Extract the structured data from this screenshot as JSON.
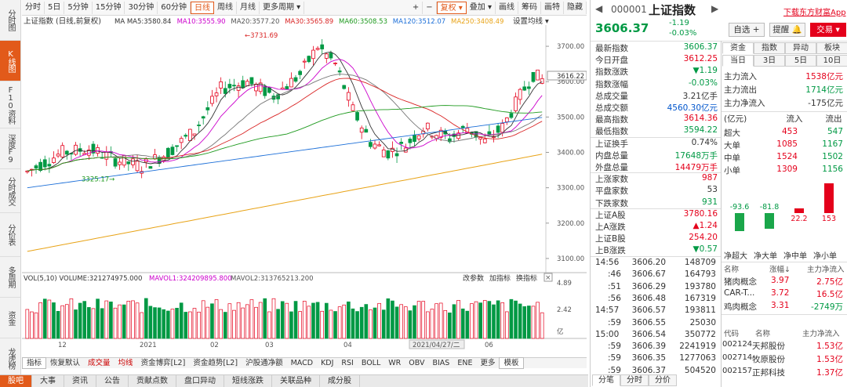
{
  "nav_left": [
    "分时图",
    "K线图",
    "F10资料",
    "深度F9",
    "分时成交",
    "分价表",
    "多周期",
    "资金",
    "龙虎榜"
  ],
  "toolbar": {
    "periods": [
      "分时",
      "5日",
      "5分钟",
      "15分钟",
      "30分钟",
      "60分钟",
      "日线",
      "周线",
      "月线",
      "更多周期"
    ],
    "active": "日线",
    "right": [
      "+",
      "−",
      "复权",
      "叠加",
      "画线",
      "筹码",
      "画特",
      "隐藏"
    ]
  },
  "chart": {
    "title": "上证指数 (日线,前复权)",
    "ma": [
      {
        "t": "MA MA5:3580.84",
        "c": "#333"
      },
      {
        "t": "MA10:3555.90",
        "c": "#cc00cc"
      },
      {
        "t": "MA20:3577.20",
        "c": "#555"
      },
      {
        "t": "MA30:3565.89",
        "c": "#d92424"
      },
      {
        "t": "MA60:3508.53",
        "c": "#1f9a1f"
      },
      {
        "t": "MA120:3512.07",
        "c": "#1c6fd8"
      },
      {
        "t": "MA250:3408.49",
        "c": "#e8a317"
      }
    ],
    "set_label": "设置均线",
    "high_label": "3731.69",
    "low_label": "3325.17",
    "last_label": "3616.22",
    "y_ticks": [
      "3700.00",
      "3600.00",
      "3500.00",
      "3400.00",
      "3300.00",
      "3200.00",
      "3100.00"
    ],
    "vol_title": "VOL(5,10) VOLUME:321274975.000",
    "vol_ma1": "MAVOL1:324209895.800",
    "vol_ma2": "MAVOL2:313765213.200",
    "vol_ticks": [
      "4.89",
      "2.42",
      "亿"
    ],
    "vol_tools": [
      "改参数",
      "加指标",
      "换指标"
    ],
    "x_ticks": [
      "12",
      "2021",
      "02",
      "03",
      "04",
      "2021/04/27/二",
      "06"
    ]
  },
  "bottom_tabs": [
    "指标",
    "恢复默认",
    "成交量",
    "均线",
    "资金博弈[L2]",
    "资金趋势[L2]",
    "沪股通净额",
    "MACD",
    "KDJ",
    "RSI",
    "BOLL",
    "WR",
    "OBV",
    "BIAS",
    "ENE",
    "更多",
    "模板"
  ],
  "bottom_nav": [
    "股吧",
    "大事",
    "资讯",
    "公告",
    "贡献点数",
    "盘口异动",
    "短线涨跌",
    "关联品种",
    "成分股"
  ],
  "right": {
    "code": "000001",
    "name": "上证指数",
    "download": "下载东方财富App",
    "price": "3606.37",
    "chg": "-1.19",
    "pct": "-0.03%",
    "btns": [
      "自选",
      "提醒",
      "交易"
    ],
    "stats": [
      [
        "最新指数",
        "3606.37",
        "grn"
      ],
      [
        "今日开盘",
        "3612.25",
        "red"
      ],
      [
        "指数涨跌",
        "▼1.19",
        "grn"
      ],
      [
        "指数涨幅",
        "-0.03%",
        "grn"
      ],
      [
        "总成交量",
        "3.21亿手",
        ""
      ],
      [
        "总成交额",
        "4560.30亿元",
        "blu"
      ],
      [
        "最高指数",
        "3614.36",
        "red"
      ],
      [
        "最低指数",
        "3594.22",
        "grn"
      ],
      [
        "上证换手",
        "0.74%",
        ""
      ],
      [
        "内盘总量",
        "17648万手",
        "grn"
      ],
      [
        "外盘总量",
        "14479万手",
        "red"
      ],
      [
        "上涨家数",
        "987",
        "red"
      ],
      [
        "平盘家数",
        "53",
        ""
      ],
      [
        "下跌家数",
        "931",
        "grn"
      ],
      [
        "上证A股",
        "3780.16",
        "red"
      ],
      [
        "上A涨跌",
        "▲1.24",
        "red"
      ],
      [
        "上证B股",
        "254.20",
        "red"
      ],
      [
        "上B涨跌",
        "▼0.57",
        "grn"
      ]
    ],
    "ticks": [
      [
        "14:56",
        "3606.20",
        "148709"
      ],
      [
        ":46",
        "3606.67",
        "164793"
      ],
      [
        ":51",
        "3606.29",
        "193780"
      ],
      [
        ":56",
        "3606.48",
        "167319"
      ],
      [
        "14:57",
        "3606.57",
        "193811"
      ],
      [
        ":59",
        "3606.55",
        "25030"
      ],
      [
        "15:00",
        "3606.54",
        "350772"
      ],
      [
        ":59",
        "3606.39",
        "2241919"
      ],
      [
        ":59",
        "3606.35",
        "1277063"
      ],
      [
        ":59",
        "3606.37",
        "504520"
      ]
    ],
    "tick_tabs": [
      "分笔",
      "分时",
      "分价"
    ],
    "fund_tabs": [
      "资金",
      "指数",
      "异动",
      "板块"
    ],
    "fund_sub": [
      "当日",
      "3日",
      "5日",
      "10日"
    ],
    "fund_flow": [
      [
        "主力流入",
        "1538亿元",
        "red"
      ],
      [
        "主力流出",
        "1714亿元",
        "grn"
      ],
      [
        "主力净流入",
        "-175亿元",
        ""
      ]
    ],
    "flow_head": [
      "(亿元)",
      "流入",
      "流出"
    ],
    "flow_rows": [
      [
        "超大",
        "453",
        "547"
      ],
      [
        "大单",
        "1085",
        "1167"
      ],
      [
        "中单",
        "1524",
        "1502"
      ],
      [
        "小单",
        "1309",
        "1156"
      ]
    ],
    "bars": [
      {
        "v": "-93.6",
        "n": -93.6
      },
      {
        "v": "-81.8",
        "n": -81.8
      },
      {
        "v": "22.2",
        "n": 22.2
      },
      {
        "v": "153",
        "n": 153
      }
    ],
    "bar_labels": [
      "净超大",
      "净大单",
      "净中单",
      "净小单"
    ],
    "concept_head": [
      "名称",
      "涨幅↓",
      "主力净流入"
    ],
    "concepts": [
      [
        "猪肉概念",
        "3.97",
        "2.75亿"
      ],
      [
        "CAR-T...",
        "3.72",
        "16.5亿"
      ],
      [
        "鸡肉概念",
        "3.31",
        "-2749万"
      ]
    ],
    "stock_head": [
      "代码",
      "名称",
      "主力净流入"
    ],
    "stocks": [
      [
        "002124",
        "天邦股份",
        "1.53亿"
      ],
      [
        "002714",
        "牧原股份",
        "1.53亿"
      ],
      [
        "002157",
        "正邦科技",
        "1.37亿"
      ]
    ]
  }
}
